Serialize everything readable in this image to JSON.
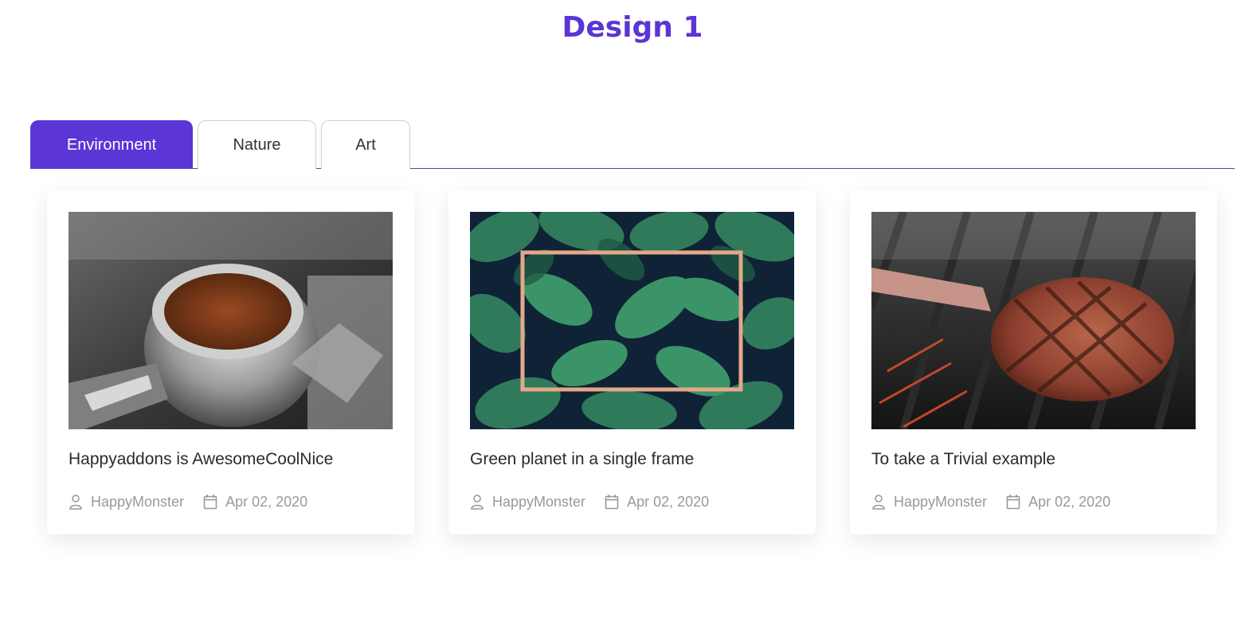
{
  "page": {
    "title": "Design 1"
  },
  "tabs": [
    {
      "label": "Environment",
      "active": true
    },
    {
      "label": "Nature",
      "active": false
    },
    {
      "label": "Art",
      "active": false
    }
  ],
  "colors": {
    "accent": "#5b35d5",
    "tab_rule": "#6b3a8e",
    "meta_text": "#999999"
  },
  "posts": [
    {
      "image": "coffee-portafilter-photo",
      "title": "Happyaddons is AwesomeCoolNice",
      "author": "HappyMonster",
      "date": "Apr 02, 2020"
    },
    {
      "image": "green-leaves-gold-frame-photo",
      "title": "Green planet in a single frame",
      "author": "HappyMonster",
      "date": "Apr 02, 2020"
    },
    {
      "image": "grilled-steak-photo",
      "title": "To take a Trivial example",
      "author": "HappyMonster",
      "date": "Apr 02, 2020"
    }
  ],
  "icons": {
    "author": "user-icon",
    "date": "calendar-icon"
  }
}
